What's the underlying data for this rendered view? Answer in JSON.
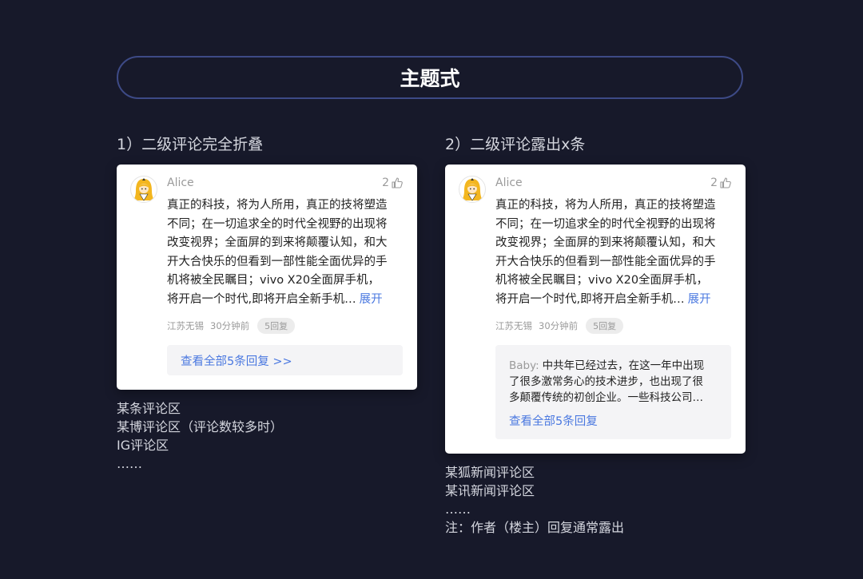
{
  "page_title": "主题式",
  "left": {
    "heading": "1）二级评论完全折叠",
    "card": {
      "username": "Alice",
      "likes": "2",
      "body_lines": [
        "真正的科技，将为人所用，真正的技将塑造",
        "不同；在一切追求全的时代全视野的出现将",
        "改变视界；全面屏的到来将颠覆认知，和大",
        "开大合快乐的但看到一部性能全面优异的手",
        "机将被全民瞩目；vivo X20全面屏手机，",
        "将开启一个时代,即将开启全新手机…"
      ],
      "expand_label": "展开",
      "location": "江苏无锡",
      "time": "30分钟前",
      "reply_badge": "5回复",
      "view_all": "查看全部5条回复 >>"
    },
    "captions": [
      "某条评论区",
      "某博评论区（评论数较多时）",
      "IG评论区",
      "……"
    ]
  },
  "right": {
    "heading": "2）二级评论露出x条",
    "card": {
      "username": "Alice",
      "likes": "2",
      "body_lines": [
        "真正的科技，将为人所用，真正的技将塑造",
        "不同；在一切追求全的时代全视野的出现将",
        "改变视界；全面屏的到来将颠覆认知，和大",
        "开大合快乐的但看到一部性能全面优异的手",
        "机将被全民瞩目；vivo X20全面屏手机，",
        "将开启一个时代,即将开启全新手机…"
      ],
      "expand_label": "展开",
      "location": "江苏无锡",
      "time": "30分钟前",
      "reply_badge": "5回复",
      "reply": {
        "author": "Baby:",
        "lines": [
          "中共年已经过去，在这一年中出现",
          "了很多激常务心的技术进步，也出现了很",
          "多颠覆传统的初创企业。一些科技公司…"
        ]
      },
      "view_all": "查看全部5条回复"
    },
    "captions": [
      "某狐新闻评论区",
      "某讯新闻评论区",
      "……",
      "注：作者（楼主）回复通常露出"
    ]
  },
  "icons": {
    "avatar": "cartoon-girl-avatar",
    "like": "thumbs-up-icon"
  },
  "colors": {
    "background": "#17192a",
    "pill_border": "#3d4a86",
    "link": "#4a78e0"
  }
}
